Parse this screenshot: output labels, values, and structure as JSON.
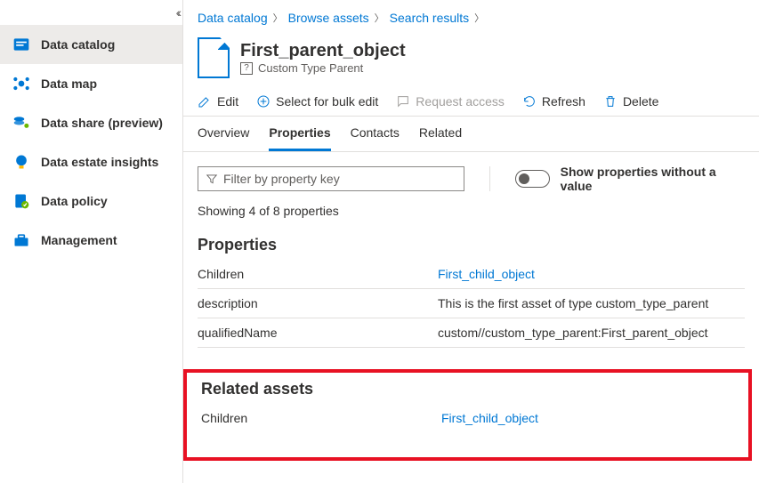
{
  "sidebar": {
    "items": [
      {
        "label": "Data catalog"
      },
      {
        "label": "Data map"
      },
      {
        "label": "Data share (preview)"
      },
      {
        "label": "Data estate insights"
      },
      {
        "label": "Data policy"
      },
      {
        "label": "Management"
      }
    ]
  },
  "breadcrumb": {
    "items": [
      "Data catalog",
      "Browse assets",
      "Search results"
    ]
  },
  "header": {
    "title": "First_parent_object",
    "subtitle": "Custom Type Parent"
  },
  "toolbar": {
    "edit": "Edit",
    "bulk": "Select for bulk edit",
    "request": "Request access",
    "refresh": "Refresh",
    "delete": "Delete"
  },
  "tabs": {
    "overview": "Overview",
    "properties": "Properties",
    "contacts": "Contacts",
    "related": "Related"
  },
  "filter": {
    "placeholder": "Filter by property key",
    "toggle_label": "Show properties without a value"
  },
  "showing": "Showing 4 of 8 properties",
  "sections": {
    "properties_title": "Properties",
    "related_title": "Related assets"
  },
  "properties": [
    {
      "key": "Children",
      "value": "First_child_object",
      "link": true
    },
    {
      "key": "description",
      "value": "This is the first asset of type custom_type_parent",
      "link": false
    },
    {
      "key": "qualifiedName",
      "value": "custom//custom_type_parent:First_parent_object",
      "link": false
    }
  ],
  "related_assets": [
    {
      "key": "Children",
      "value": "First_child_object"
    }
  ]
}
